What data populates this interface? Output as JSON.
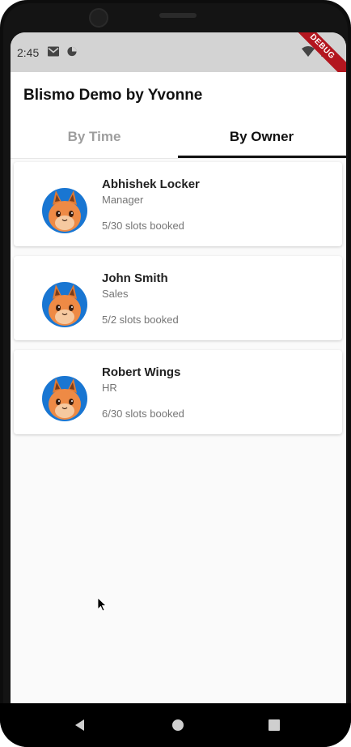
{
  "status_bar": {
    "time": "2:45",
    "icons": [
      "gmail-icon",
      "data-saver-icon",
      "wifi-icon",
      "battery-icon"
    ],
    "debug_banner": "DEBUG"
  },
  "app_bar": {
    "title": "Blismo Demo by Yvonne"
  },
  "tabs": [
    {
      "label": "By Time",
      "selected": false
    },
    {
      "label": "By Owner",
      "selected": true
    }
  ],
  "owners": [
    {
      "name": "Abhishek Locker",
      "role": "Manager",
      "slots": "5/30 slots booked",
      "avatar": "squirrel-avatar"
    },
    {
      "name": "John Smith",
      "role": "Sales",
      "slots": "5/2 slots booked",
      "avatar": "squirrel-avatar"
    },
    {
      "name": "Robert Wings",
      "role": "HR",
      "slots": "6/30 slots booked",
      "avatar": "squirrel-avatar"
    }
  ],
  "nav_bar": {
    "buttons": [
      "back-icon",
      "home-icon",
      "recents-icon"
    ]
  },
  "colors": {
    "avatar_bg": "#1976d2",
    "tab_indicator": "#111111",
    "debug_banner": "#b3161f"
  }
}
